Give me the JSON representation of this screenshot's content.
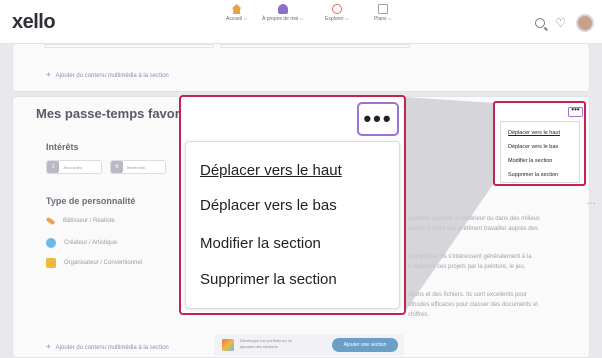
{
  "header": {
    "logo": "xello",
    "nav": [
      {
        "icon": "house-icon",
        "label": "Accueil ⌵"
      },
      {
        "icon": "person-icon",
        "label": "À propos de moi ⌵"
      },
      {
        "icon": "compass-icon",
        "label": "Explorer ⌵"
      },
      {
        "icon": "document-icon",
        "label": "Plans ⌵"
      }
    ]
  },
  "page": {
    "add_media": "Ajouter du contenu multimédia à la section",
    "add_media_bottom": "Ajouter du contenu multimédia à la section",
    "section_title": "Mes passe-temps favori",
    "interests_title": "Intérêts",
    "chips": [
      {
        "tag": "J",
        "label": "Jeux vidéo"
      },
      {
        "tag": "B",
        "label": "Bénévolat"
      }
    ],
    "personality_title": "Type de personnalité",
    "personality": [
      "Bâtisseur / Réaliste",
      "Créateur / Artistique",
      "Organisateur / Conventionnel"
    ],
    "body_lines": [
      "availlent souvent à l'extérieur ou dans des milieux",
      "isieurs d'entre eux préfèrent travailler auprès des",
      "rt physique. Ils s'intéressent généralement à la",
      "s réalisent ces projets par la peinture, le jeu,",
      "ations et des fichiers. Ils sont excellents pour",
      "éthodes efficaces pour classer des documents et",
      "chiffres."
    ],
    "promo_text": "Développe ton portfolio en lui ajoutant des sections.",
    "promo_button": "Ajouter une section",
    "ellipsis": "…"
  },
  "menu": {
    "dots": "•••",
    "items": [
      "Déplacer vers le haut",
      "Déplacer vers le bas",
      "Modifier la section",
      "Supprimer la section"
    ]
  },
  "colors": {
    "highlight_frame": "#c4234f",
    "dots_frame": "#9a73d4",
    "accent": "#6aa0c8"
  }
}
